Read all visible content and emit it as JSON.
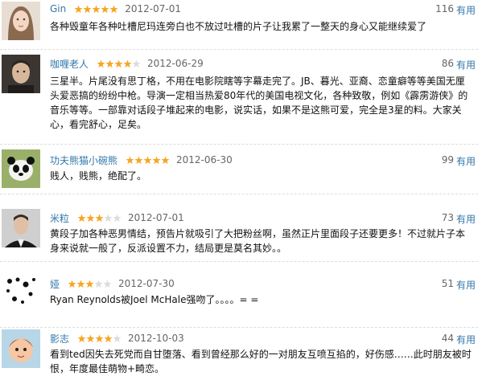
{
  "colors": {
    "link": "#3377aa",
    "star_on": "#f6a623",
    "star_off": "#dcdcdc",
    "divider": "#dddddd"
  },
  "reviews": [
    {
      "author": "Gin",
      "rating": 5,
      "date": "2012-07-01",
      "votes": "116",
      "useful_label": "有用",
      "text": "各种毁童年各种吐槽尼玛连旁白也不放过吐槽的片子让我累了一整天的身心又能继续爱了",
      "avatar_icon": "woman-portrait-icon"
    },
    {
      "author": "咖喱老人",
      "rating": 4,
      "date": "2012-06-29",
      "votes": "86",
      "useful_label": "有用",
      "text": "三星半。片尾没有思丁格，不用在电影院瞎等字幕走完了。JB、暮光、亚裔、恋童癖等等美国无厘头爱恶搞的纷纷中枪。导演一定相当热爱80年代的美国电视文化，各种致敬，例如《霹雳游侠》的音乐等等。一部靠对话段子堆起来的电影，说实话，如果不是这熊可爱，完全是3星的料。大家关心，看完舒心，足矣。",
      "avatar_icon": "man-portrait-icon"
    },
    {
      "author": "功夫熊猫小碗熊",
      "rating": 5,
      "date": "2012-06-30",
      "votes": "99",
      "useful_label": "有用",
      "text": "贱人，贱熊，绝配了。",
      "avatar_icon": "panda-icon"
    },
    {
      "author": "米粒",
      "rating": 3,
      "date": "2012-07-01",
      "votes": "73",
      "useful_label": "有用",
      "text": "黄段子加各种恶男情结，预告片就吸引了大把粉丝啊，虽然正片里面段子还要更多！不过就片子本身来说就一般了，反派设置不力，结局更是莫名其妙。。",
      "avatar_icon": "man-suit-icon"
    },
    {
      "author": "娅",
      "rating": 3,
      "date": "2012-07-30",
      "votes": "51",
      "useful_label": "有用",
      "text": "Ryan Reynolds被Joel McHale强吻了。。。。= =",
      "avatar_icon": "dots-pattern-icon"
    },
    {
      "author": "影志",
      "rating": 4,
      "date": "2012-10-03",
      "votes": "44",
      "useful_label": "有用",
      "text": "看到ted因失去死党而自甘堕落、看到曾经那么好的一对朋友互喷互掐的，好伤感……此时朋友被时恨，年度最佳萌物+畸恋。",
      "avatar_icon": "cartoon-girl-icon"
    }
  ]
}
